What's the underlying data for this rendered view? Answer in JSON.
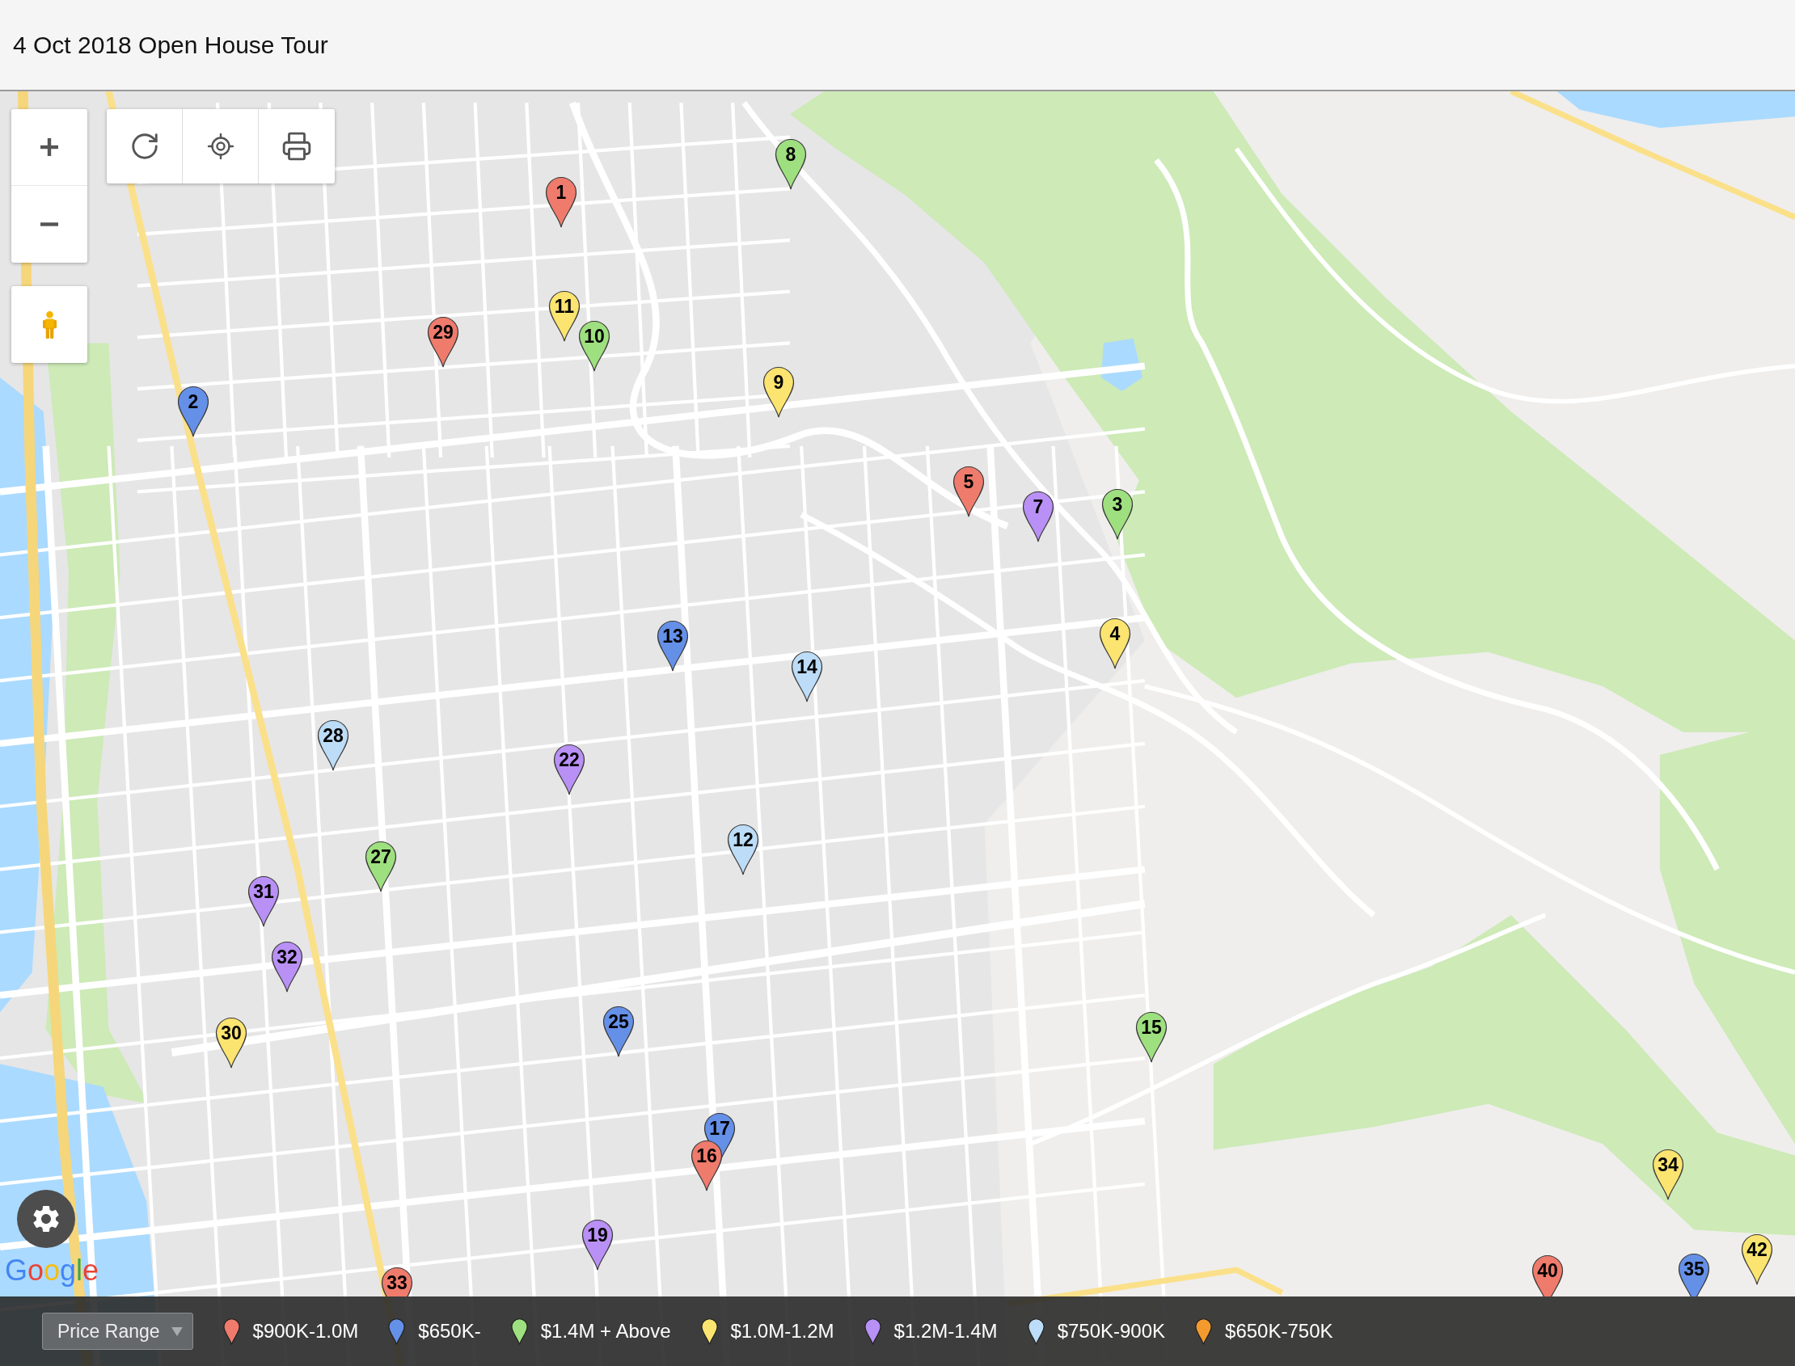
{
  "header": {
    "title": "4 Oct 2018 Open House Tour"
  },
  "map": {
    "pins": [
      {
        "label": "8",
        "color": "#9ee07f"
      },
      {
        "label": "1",
        "color": "#ef7b6c"
      },
      {
        "label": "11",
        "color": "#fbe46f"
      },
      {
        "label": "29",
        "color": "#ef7b6c"
      },
      {
        "label": "10",
        "color": "#9ee07f"
      },
      {
        "label": "9",
        "color": "#fbe46f"
      },
      {
        "label": "2",
        "color": "#6590e8"
      },
      {
        "label": "5",
        "color": "#ef7b6c"
      },
      {
        "label": "3",
        "color": "#9ee07f"
      },
      {
        "label": "7",
        "color": "#b990f5"
      },
      {
        "label": "4",
        "color": "#fbe46f"
      },
      {
        "label": "13",
        "color": "#6590e8"
      },
      {
        "label": "14",
        "color": "#bcdcf7"
      },
      {
        "label": "28",
        "color": "#bcdcf7"
      },
      {
        "label": "22",
        "color": "#b990f5"
      },
      {
        "label": "12",
        "color": "#bcdcf7"
      },
      {
        "label": "27",
        "color": "#9ee07f"
      },
      {
        "label": "31",
        "color": "#b990f5"
      },
      {
        "label": "32",
        "color": "#b990f5"
      },
      {
        "label": "25",
        "color": "#6590e8"
      },
      {
        "label": "15",
        "color": "#9ee07f"
      },
      {
        "label": "30",
        "color": "#fbe46f"
      },
      {
        "label": "17",
        "color": "#6590e8"
      },
      {
        "label": "16",
        "color": "#ef7b6c"
      },
      {
        "label": "34",
        "color": "#fbe46f"
      },
      {
        "label": "19",
        "color": "#b990f5"
      },
      {
        "label": "42",
        "color": "#fbe46f"
      },
      {
        "label": "35",
        "color": "#6590e8"
      },
      {
        "label": "40",
        "color": "#ef7b6c"
      },
      {
        "label": "33",
        "color": "#ef7b6c"
      }
    ],
    "logo": "Google"
  },
  "legend": {
    "dropdown": {
      "label": "Price Range"
    },
    "items": [
      {
        "label": "$900K-1.0M",
        "color": "#ef7b6c"
      },
      {
        "label": "$650K-",
        "color": "#6590e8"
      },
      {
        "label": "$1.4M + Above",
        "color": "#9ee07f"
      },
      {
        "label": "$1.0M-1.2M",
        "color": "#fbe46f"
      },
      {
        "label": "$1.2M-1.4M",
        "color": "#b990f5"
      },
      {
        "label": "$750K-900K",
        "color": "#bcdcf7"
      },
      {
        "label": "$650K-750K",
        "color": "#f39a2e"
      }
    ]
  }
}
